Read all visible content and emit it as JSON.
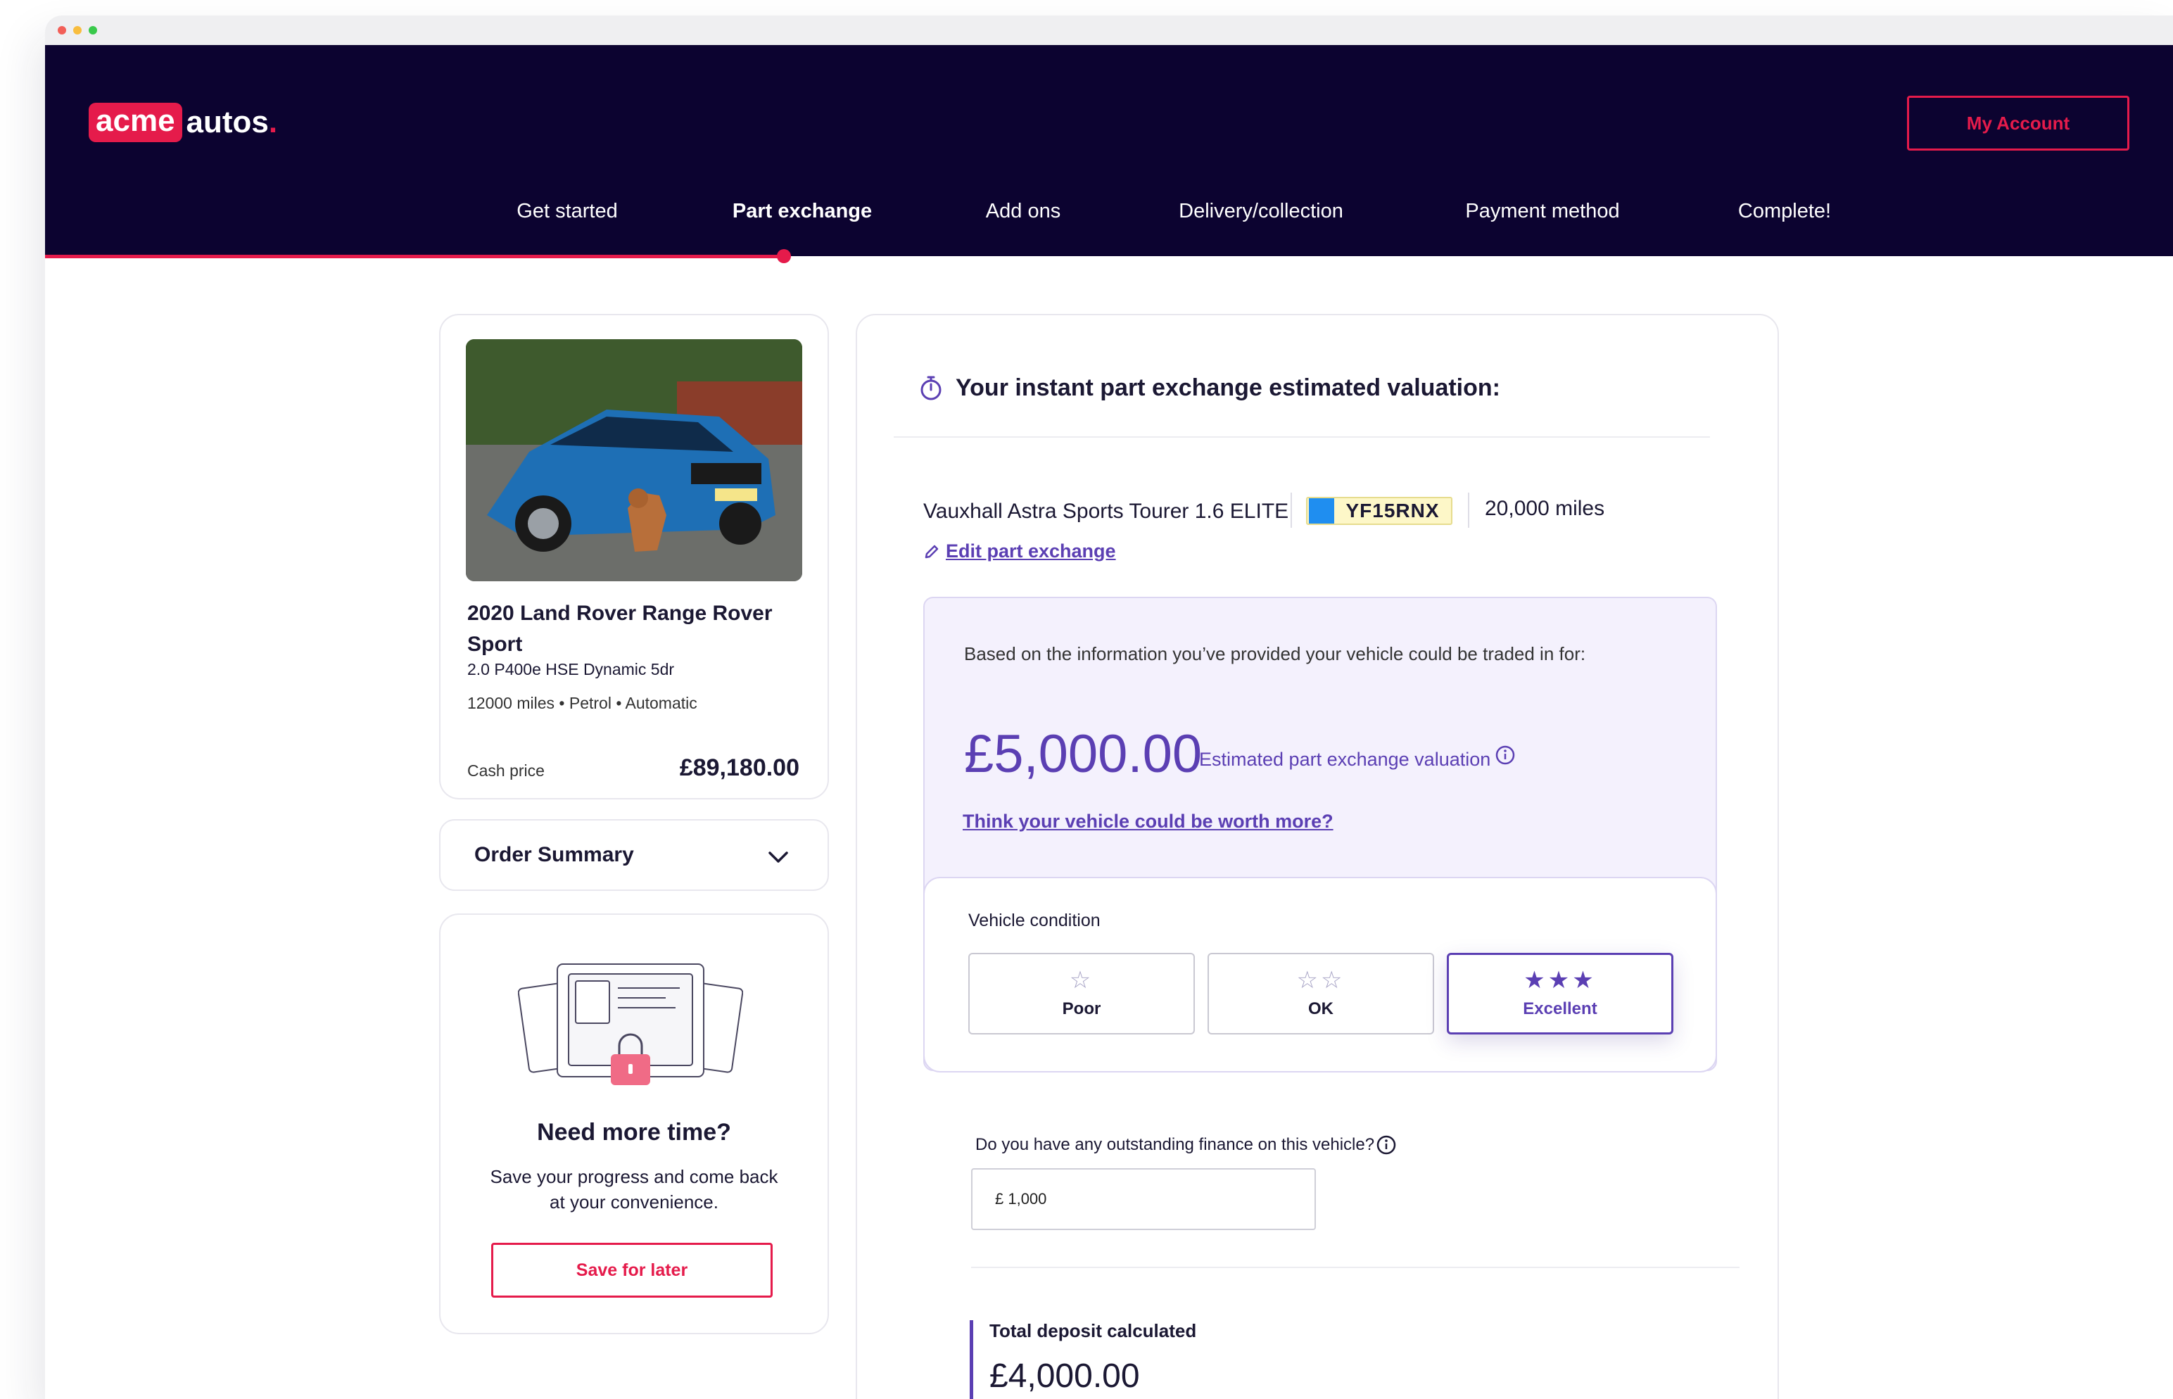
{
  "header": {
    "logo_box": "acme",
    "logo_text": "autos",
    "logo_dot": ".",
    "account_button": "My Account"
  },
  "steps": [
    {
      "label": "Get started",
      "active": false
    },
    {
      "label": "Part exchange",
      "active": true
    },
    {
      "label": "Add ons",
      "active": false
    },
    {
      "label": "Delivery/collection",
      "active": false
    },
    {
      "label": "Payment method",
      "active": false
    },
    {
      "label": "Complete!",
      "active": false
    }
  ],
  "car": {
    "title": "2020 Land Rover Range Rover Sport",
    "subtitle": "2.0 P400e HSE Dynamic 5dr",
    "meta": "12000 miles • Petrol • Automatic",
    "cash_label": "Cash price",
    "cash_value": "£89,180.00"
  },
  "summary": {
    "label": "Order Summary"
  },
  "save": {
    "title": "Need more time?",
    "text": "Save your progress and come back at your convenience.",
    "button": "Save for later"
  },
  "valuation": {
    "heading": "Your instant part exchange estimated valuation:",
    "vehicle_name": "Vauxhall Astra Sports Tourer 1.6 ELITE",
    "plate": "YF15RNX",
    "miles": "20,000 miles",
    "edit_link": "Edit part exchange",
    "note": "Based on the information you’ve provided your vehicle could be traded in for:",
    "amount": "£5,000.00",
    "amount_label": "Estimated part exchange valuation",
    "worth_link": "Think your vehicle could be worth more?",
    "condition_label": "Vehicle condition",
    "options": [
      {
        "label": "Poor",
        "stars": "☆",
        "selected": false
      },
      {
        "label": "OK",
        "stars": "☆☆",
        "selected": false
      },
      {
        "label": "Excellent",
        "stars": "★★★",
        "selected": true
      }
    ]
  },
  "finance": {
    "question": "Do you have any outstanding finance on this vehicle?",
    "value": "£ 1,000"
  },
  "deposit": {
    "label": "Total deposit calculated",
    "amount": "£4,000.00"
  },
  "colors": {
    "brand_red": "#e51b4b",
    "navy": "#0c0330",
    "purple": "#5b3fb3",
    "lavender_bg": "#f4f1fd"
  }
}
